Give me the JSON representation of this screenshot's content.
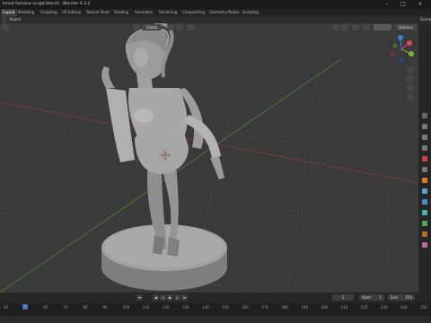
{
  "window": {
    "title": "kmod Sylvane sculpt.blend] - Blender 4.3.2",
    "controls": [
      "–",
      "□",
      "×"
    ]
  },
  "workspace_tabs": [
    {
      "label": "Layout",
      "active": true
    },
    {
      "label": "Modeling",
      "active": false
    },
    {
      "label": "Sculpting",
      "active": false
    },
    {
      "label": "UV Editing",
      "active": false
    },
    {
      "label": "Texture Paint",
      "active": false
    },
    {
      "label": "Shading",
      "active": false
    },
    {
      "label": "Animation",
      "active": false
    },
    {
      "label": "Rendering",
      "active": false
    },
    {
      "label": "Compositing",
      "active": false
    },
    {
      "label": "Geometry Nodes",
      "active": false
    },
    {
      "label": "Scripting",
      "active": false
    }
  ],
  "header": {
    "menu_object": "Object",
    "transform_orientation": "Global",
    "options_label": "Options",
    "scene_label": "Scene"
  },
  "timeline": {
    "current_frame": "1",
    "start_label": "Start",
    "start_value": "1",
    "end_label": "End",
    "end_value": "250",
    "playhead_frame": "1"
  },
  "ruler_ticks": [
    "40",
    "50",
    "60",
    "70",
    "80",
    "90",
    "100",
    "110",
    "120",
    "130",
    "140",
    "150",
    "160",
    "170",
    "180",
    "190",
    "200",
    "210",
    "220",
    "230",
    "240",
    "250"
  ],
  "icons": {
    "gizmo_x": "axis-x-icon",
    "gizmo_y": "axis-y-icon",
    "gizmo_z": "axis-z-icon",
    "zoom": "zoom-icon",
    "pan": "pan-hand-icon",
    "camera": "camera-icon",
    "perspective": "grid-view-icon"
  },
  "colors": {
    "axis_x": "#e04758",
    "axis_y": "#7fb135",
    "axis_z": "#3f7fe0",
    "playhead": "#3b6db8",
    "model": "#9c9c9c"
  }
}
